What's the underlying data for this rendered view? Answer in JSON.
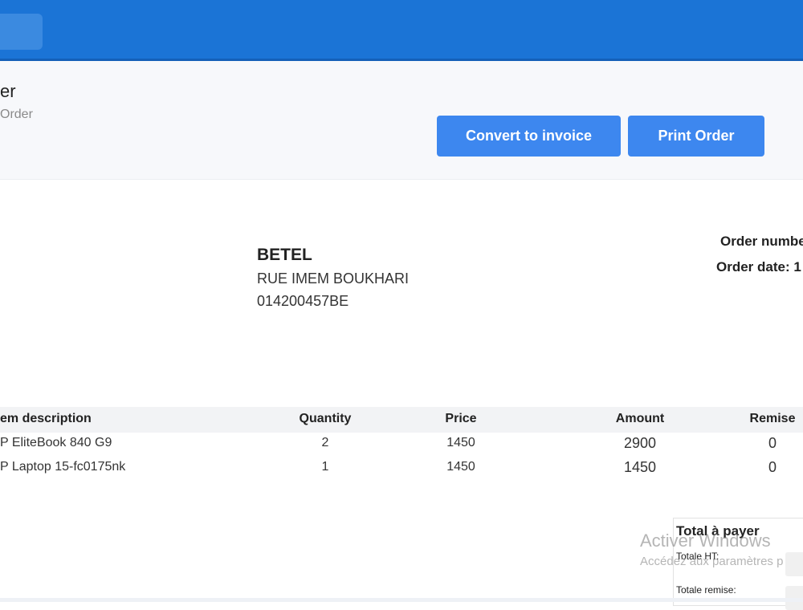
{
  "header": {
    "title": "er",
    "breadcrumb": "Order",
    "convert_label": "Convert to invoice",
    "print_label": "Print Order"
  },
  "company": {
    "name": "BETEL",
    "address": "RUE IMEM BOUKHARI",
    "tax_id": "014200457BE"
  },
  "order_meta": {
    "number_label": "Order numbe",
    "date_label": "Order date: 1"
  },
  "table": {
    "headers": [
      "em description",
      "Quantity",
      "Price",
      "Amount",
      "Remise"
    ],
    "rows": [
      {
        "description": "P EliteBook 840 G9",
        "quantity": "2",
        "price": "1450",
        "amount": "2900",
        "remise": "0"
      },
      {
        "description": "P Laptop 15-fc0175nk",
        "quantity": "1",
        "price": "1450",
        "amount": "1450",
        "remise": "0"
      }
    ]
  },
  "totals": {
    "title": "Total à payer",
    "ht_label": "Totale HT:",
    "remise_label": "Totale remise:"
  },
  "watermark": {
    "line1": "Activer Windows",
    "line2": "Accédez aux paramètres p"
  },
  "colors": {
    "topbar": "#1b74d6",
    "button": "#3d87ef"
  }
}
